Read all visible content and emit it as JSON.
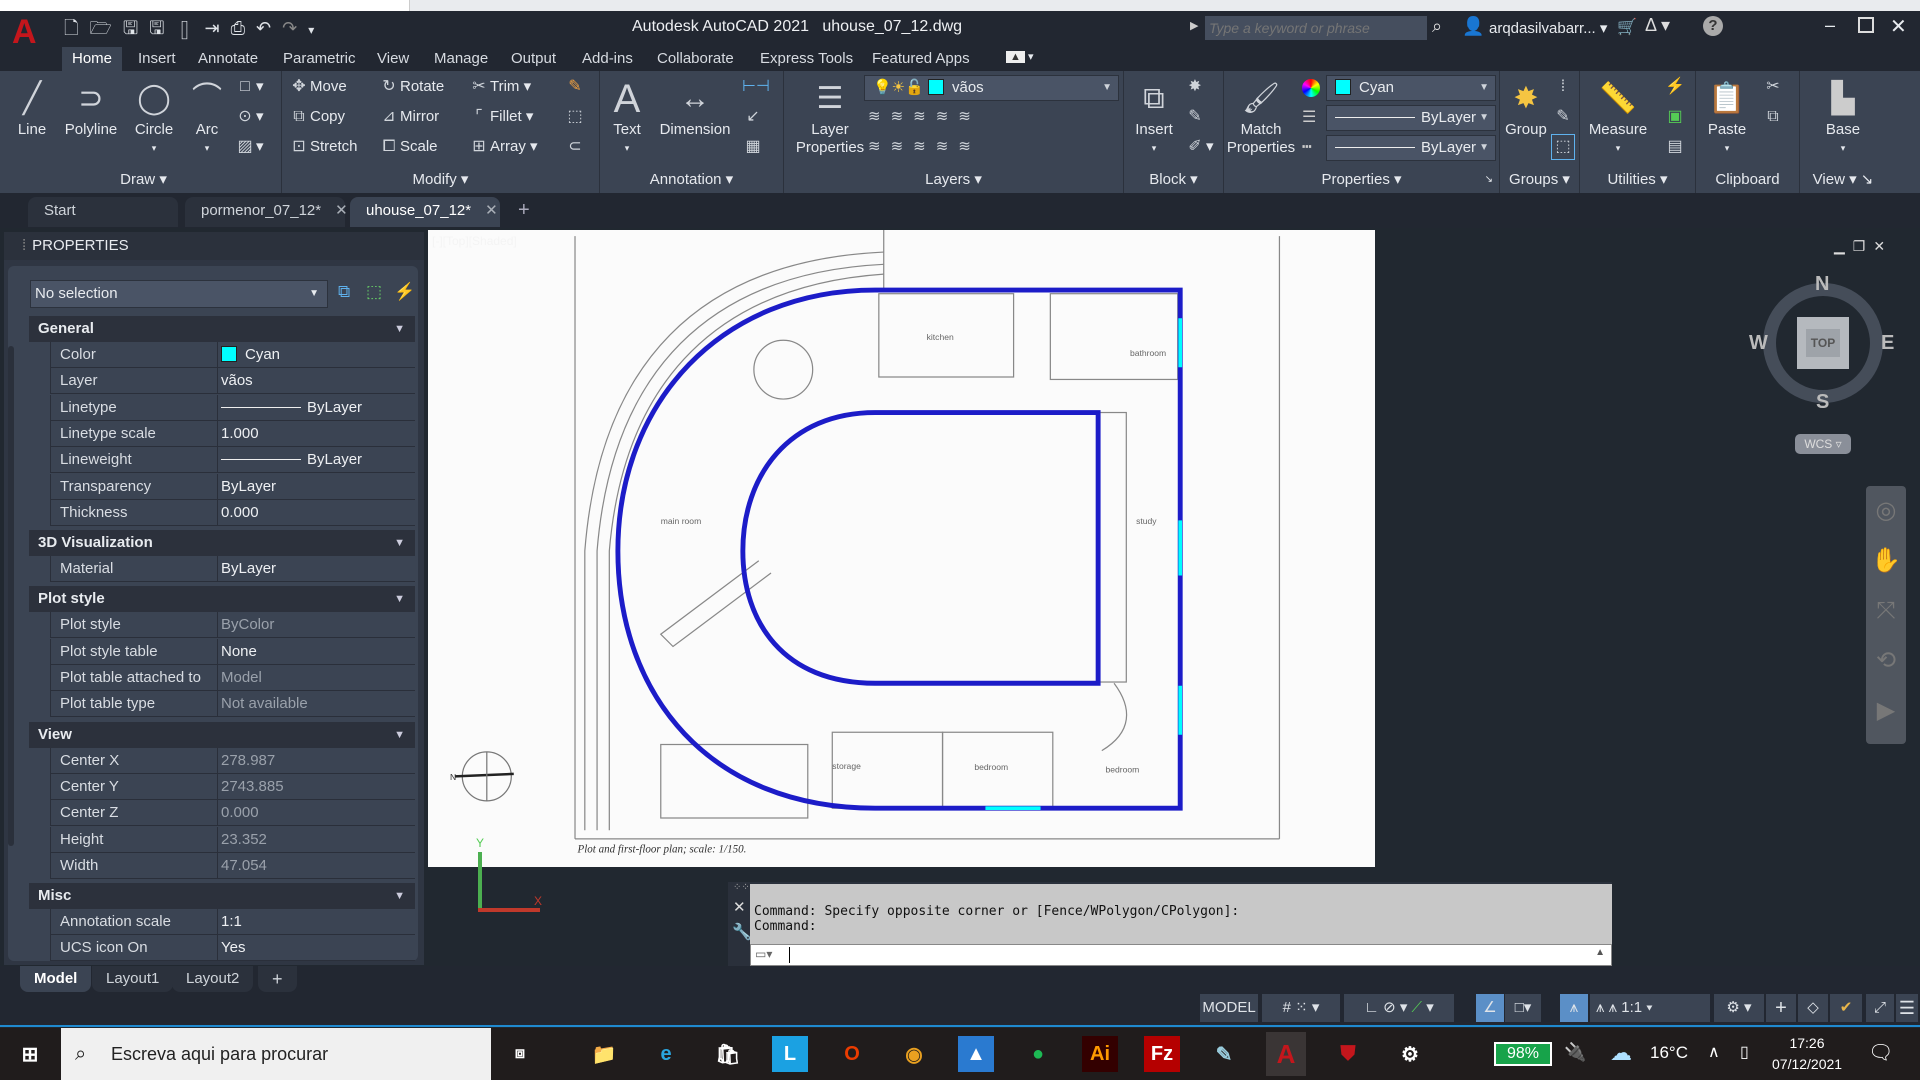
{
  "titlebar": {
    "app_title": "Autodesk AutoCAD 2021",
    "file_name": "uhouse_07_12.dwg",
    "search_placeholder": "Type a keyword or phrase",
    "user": "arqdasilvabarr...",
    "icons": [
      "new-icon",
      "open-icon",
      "save-icon",
      "save-as-icon",
      "web-mobile-icon",
      "share-icon",
      "plot-icon",
      "undo-icon",
      "redo-icon",
      "customize-icon",
      "search-icon",
      "user-icon",
      "cart-icon",
      "autodesk-app-icon",
      "help-icon"
    ]
  },
  "menu_tabs": [
    "Home",
    "Insert",
    "Annotate",
    "Parametric",
    "View",
    "Manage",
    "Output",
    "Add-ins",
    "Collaborate",
    "Express Tools",
    "Featured Apps"
  ],
  "ribbon": {
    "draw": {
      "label": "Draw",
      "items": [
        "Line",
        "Polyline",
        "Circle",
        "Arc"
      ]
    },
    "modify": {
      "label": "Modify",
      "items": [
        "Move",
        "Rotate",
        "Trim",
        "Copy",
        "Mirror",
        "Fillet",
        "Stretch",
        "Scale",
        "Array"
      ]
    },
    "annotation": {
      "label": "Annotation",
      "items": [
        "Text",
        "Dimension"
      ]
    },
    "layers": {
      "label": "Layers",
      "layer_properties": "Layer\nProperties",
      "current_layer": "vãos"
    },
    "block": {
      "label": "Block",
      "insert": "Insert"
    },
    "properties": {
      "label": "Properties",
      "match": "Match\nProperties",
      "color": "Cyan",
      "linetype": "ByLayer",
      "lineweight": "ByLayer"
    },
    "groups": {
      "label": "Groups",
      "group": "Group"
    },
    "utilities": {
      "label": "Utilities",
      "measure": "Measure"
    },
    "clipboard": {
      "label": "Clipboard",
      "paste": "Paste"
    },
    "view": {
      "label": "View",
      "base": "Base"
    }
  },
  "doc_tabs": [
    {
      "label": "Start"
    },
    {
      "label": "pormenor_07_12*"
    },
    {
      "label": "uhouse_07_12*",
      "active": true
    }
  ],
  "properties_palette": {
    "title": "PROPERTIES",
    "selection": "No selection",
    "sections": [
      {
        "name": "General",
        "rows": [
          [
            "Color",
            "Cyan"
          ],
          [
            "Layer",
            "vãos"
          ],
          [
            "Linetype",
            "ByLayer"
          ],
          [
            "Linetype scale",
            "1.000"
          ],
          [
            "Lineweight",
            "ByLayer"
          ],
          [
            "Transparency",
            "ByLayer"
          ],
          [
            "Thickness",
            "0.000"
          ]
        ]
      },
      {
        "name": "3D Visualization",
        "rows": [
          [
            "Material",
            "ByLayer"
          ]
        ]
      },
      {
        "name": "Plot style",
        "rows": [
          [
            "Plot style",
            "ByColor"
          ],
          [
            "Plot style table",
            "None"
          ],
          [
            "Plot table attached to",
            "Model"
          ],
          [
            "Plot table type",
            "Not available"
          ]
        ]
      },
      {
        "name": "View",
        "rows": [
          [
            "Center X",
            "278.987"
          ],
          [
            "Center Y",
            "2743.885"
          ],
          [
            "Center Z",
            "0.000"
          ],
          [
            "Height",
            "23.352"
          ],
          [
            "Width",
            "47.054"
          ]
        ]
      },
      {
        "name": "Misc",
        "rows": [
          [
            "Annotation scale",
            "1:1"
          ],
          [
            "UCS icon On",
            "Yes"
          ]
        ]
      }
    ]
  },
  "viewport": {
    "label": "[-][Top][Shaded]",
    "rooms": [
      "kitchen",
      "bathroom",
      "main room",
      "study",
      "storage",
      "bedroom",
      "bedroom"
    ],
    "caption": "Plot and first-floor plan; scale:   1/150.",
    "north_label": "N",
    "polyline_color": "#1c1cc8",
    "window_color": "#00ffff"
  },
  "viewcube": {
    "n": "N",
    "s": "S",
    "e": "E",
    "w": "W",
    "face": "TOP",
    "wcs": "WCS"
  },
  "ucs": {
    "y": "Y",
    "x": "X"
  },
  "command": {
    "history": [
      "Command: Specify opposite corner or [Fence/WPolygon/CPolygon]:",
      "Command:"
    ],
    "input": ""
  },
  "layout_tabs": [
    "Model",
    "Layout1",
    "Layout2",
    "+"
  ],
  "statusbar": {
    "model": "MODEL",
    "annotation_scale": "1:1"
  },
  "taskbar": {
    "search_placeholder": "Escreva aqui para procurar",
    "battery": "98%",
    "temperature": "16°C",
    "time": "17:26",
    "date": "07/12/2021",
    "apps": [
      "file-explorer",
      "edge",
      "store",
      "l-app",
      "office",
      "chrome",
      "photos",
      "spotify",
      "illustrator",
      "filezilla",
      "notepad",
      "autocad",
      "mcafee",
      "settings"
    ]
  }
}
